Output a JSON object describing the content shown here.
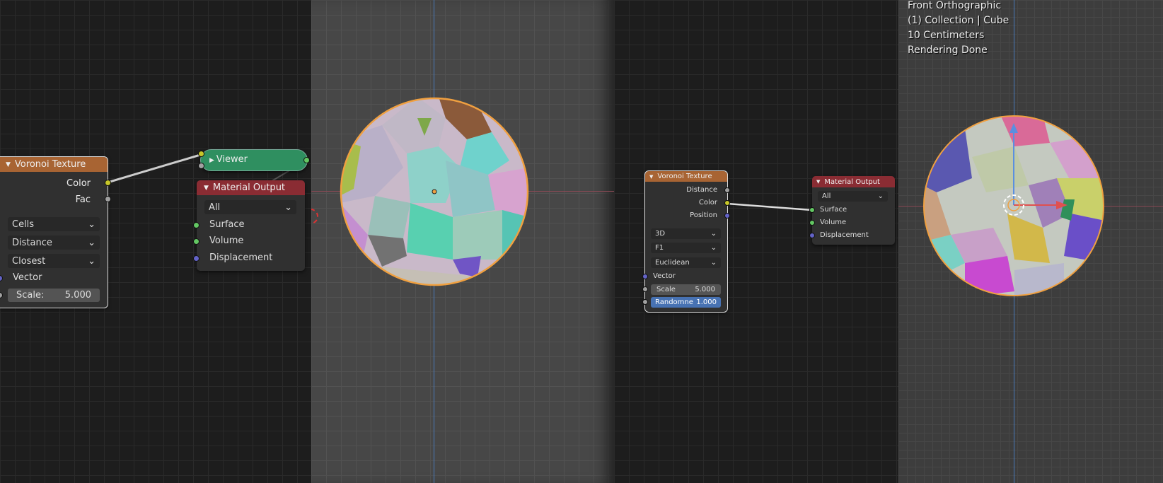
{
  "left_editor": {
    "voronoi": {
      "title": "Voronoi Texture",
      "outputs": [
        "Color",
        "Fac"
      ],
      "dropdowns": [
        "Cells",
        "Distance",
        "Closest"
      ],
      "vector": "Vector",
      "scale_label": "Scale:",
      "scale_value": "5.000"
    },
    "viewer": {
      "title": "Viewer"
    },
    "material_output": {
      "title": "Material Output",
      "target": "All",
      "inputs": [
        "Surface",
        "Volume",
        "Displacement"
      ]
    }
  },
  "right_editor": {
    "voronoi": {
      "title": "Voronoi Texture",
      "outputs": [
        "Distance",
        "Color",
        "Position"
      ],
      "dropdowns": [
        "3D",
        "F1",
        "Euclidean"
      ],
      "vector": "Vector",
      "scale_label": "Scale",
      "scale_value": "5.000",
      "randomness_label": "Randomne",
      "randomness_value": "1.000"
    },
    "material_output": {
      "title": "Material Output",
      "target": "All",
      "inputs": [
        "Surface",
        "Volume",
        "Displacement"
      ]
    }
  },
  "viewport_overlay": {
    "view": "Front Orthographic",
    "collection": "(1) Collection | Cube",
    "scale": "10 Centimeters",
    "status": "Rendering Done"
  },
  "colors": {
    "voronoi_header": "#a86433",
    "output_header": "#8a2c33",
    "viewer_header": "#2f8f60",
    "socket_color": "#c7c729",
    "socket_shader": "#63c763",
    "socket_vector": "#6363c7",
    "socket_float": "#a1a1a1"
  }
}
